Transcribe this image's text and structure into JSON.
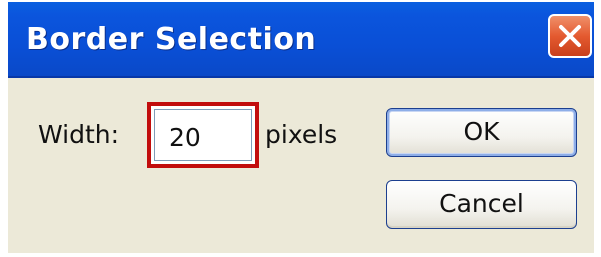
{
  "window": {
    "title": "Border Selection",
    "close_icon": "close-icon"
  },
  "form": {
    "width_label": "Width:",
    "width_value": "20",
    "unit_label": "pixels"
  },
  "buttons": {
    "ok_label": "OK",
    "cancel_label": "Cancel"
  },
  "colors": {
    "titlebar": "#0a50d8",
    "close_button": "#e45a30",
    "highlight_border": "#c20d0d",
    "dialog_background": "#ece9d8"
  }
}
